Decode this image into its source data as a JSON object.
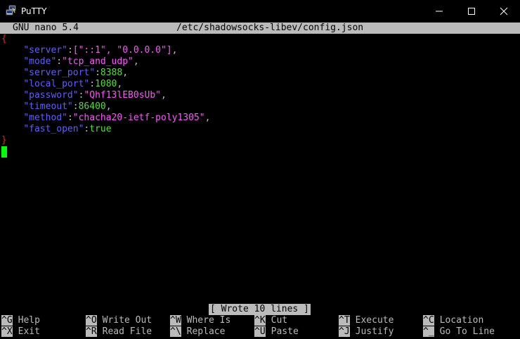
{
  "window": {
    "title": "PuTTY",
    "icon": "putty-icon",
    "controls": [
      "minimize-icon",
      "maximize-icon",
      "close-icon"
    ]
  },
  "nano": {
    "version_label": "GNU nano 5.4",
    "file_path": "/etc/shadowsocks-libev/config.json",
    "status_message": "[ Wrote 10 lines ]"
  },
  "config": {
    "open_brace": "{",
    "close_brace": "}",
    "entries": [
      {
        "key": "\"server\"",
        "sep": ":",
        "value": "[\"::1\", \"0.0.0.0\"]",
        "value_type": "str",
        "trail": ","
      },
      {
        "key": "\"mode\"",
        "sep": ":",
        "value": "\"tcp_and_udp\"",
        "value_type": "str",
        "trail": ","
      },
      {
        "key": "\"server_port\"",
        "sep": ":",
        "value": "8388",
        "value_type": "num",
        "trail": ","
      },
      {
        "key": "\"local_port\"",
        "sep": ":",
        "value": "1080",
        "value_type": "num",
        "trail": ","
      },
      {
        "key": "\"password\"",
        "sep": ":",
        "value": "\"Qhf13lEB0sUb\"",
        "value_type": "str",
        "trail": ","
      },
      {
        "key": "\"timeout\"",
        "sep": ":",
        "value": "86400",
        "value_type": "num",
        "trail": ","
      },
      {
        "key": "\"method\"",
        "sep": ":",
        "value": "\"chacha20-ietf-poly1305\"",
        "value_type": "str",
        "trail": ","
      },
      {
        "key": "\"fast_open\"",
        "sep": ":",
        "value": "true",
        "value_type": "num",
        "trail": ""
      }
    ]
  },
  "shortcuts": [
    [
      {
        "key": "^G",
        "label": "Help"
      },
      {
        "key": "^O",
        "label": "Write Out"
      },
      {
        "key": "^W",
        "label": "Where Is"
      },
      {
        "key": "^K",
        "label": "Cut"
      },
      {
        "key": "^T",
        "label": "Execute"
      },
      {
        "key": "^C",
        "label": "Location"
      }
    ],
    [
      {
        "key": "^X",
        "label": "Exit"
      },
      {
        "key": "^R",
        "label": "Read File"
      },
      {
        "key": "^\\",
        "label": "Replace"
      },
      {
        "key": "^U",
        "label": "Paste"
      },
      {
        "key": "^J",
        "label": "Justify"
      },
      {
        "key": "^_",
        "label": "Go To Line"
      }
    ]
  ],
  "colors": {
    "key": "#5f5fff",
    "string": "#ff55ff",
    "number": "#55dd33",
    "brace": "#ee2222",
    "cursor": "#00ff00",
    "bar": "#bbbbbb"
  }
}
